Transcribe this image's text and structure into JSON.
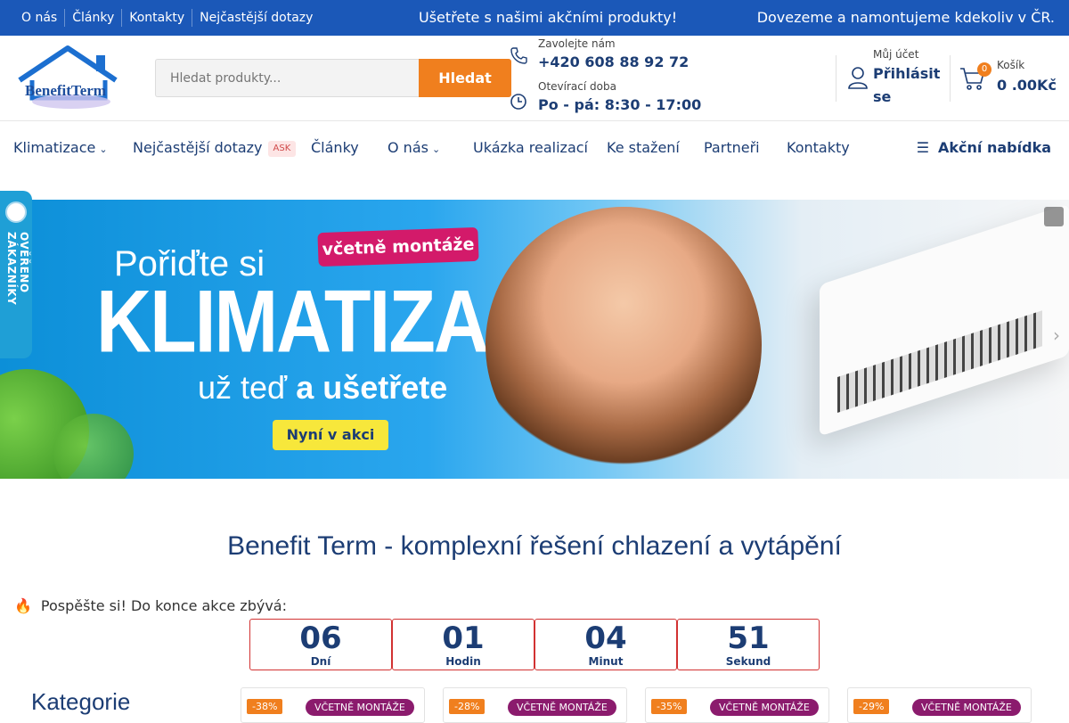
{
  "topbar": {
    "links": [
      "O nás",
      "Články",
      "Kontakty",
      "Nejčastější dotazy"
    ],
    "promo": "Ušetřete s našimi akčními produkty!",
    "delivery": "Dovezeme a namontujeme kdekoliv v ČR."
  },
  "header": {
    "logo_text": "BenefitTerm",
    "search": {
      "placeholder": "Hledat produkty...",
      "button": "Hledat"
    },
    "call": {
      "label": "Zavolejte nám",
      "phone": "+420 608 88 92 72"
    },
    "hours": {
      "label": "Otevírací doba",
      "value": "Po - pá: 8:30 - 17:00"
    },
    "account": {
      "label": "Můj účet",
      "value": "Přihlásit se"
    },
    "cart": {
      "label": "Košík",
      "count": "0",
      "value": "0 .00Kč"
    }
  },
  "nav": {
    "items": [
      "Klimatizace",
      "Nejčastější dotazy",
      "Články",
      "O nás",
      "Ukázka realizací",
      "Ke stažení",
      "Partneři",
      "Kontakty"
    ],
    "ask_badge": "ASK",
    "special": "Akční nabídka"
  },
  "hero": {
    "pill": "včetně montáže",
    "line1": "Pořiďte si",
    "line2": "KLIMATIZACI",
    "line3a": "už teď",
    "line3b": "a ušetřete",
    "cta": "Nyní v akci"
  },
  "reviews_tab": "OVĚŘENO ZÁKAZNÍKY",
  "main": {
    "heading": "Benefit Term - komplexní řešení chlazení a vytápění",
    "hurry": "Pospěšte si! Do konce akce zbývá:",
    "countdown": [
      {
        "value": "06",
        "label": "Dní"
      },
      {
        "value": "01",
        "label": "Hodin"
      },
      {
        "value": "04",
        "label": "Minut"
      },
      {
        "value": "51",
        "label": "Sekund"
      }
    ],
    "categories_title": "Kategorie",
    "products": [
      {
        "discount": "-38%",
        "badge": "VČETNĚ MONTÁŽE"
      },
      {
        "discount": "-28%",
        "badge": "VČETNĚ MONTÁŽE"
      },
      {
        "discount": "-35%",
        "badge": "VČETNĚ MONTÁŽE"
      },
      {
        "discount": "-29%",
        "badge": "VČETNĚ MONTÁŽE"
      }
    ]
  },
  "colors": {
    "brand_blue": "#1b58b8",
    "accent_orange": "#f07f1e",
    "navy": "#1c3d74",
    "badge_purple": "#8b1b6d"
  }
}
